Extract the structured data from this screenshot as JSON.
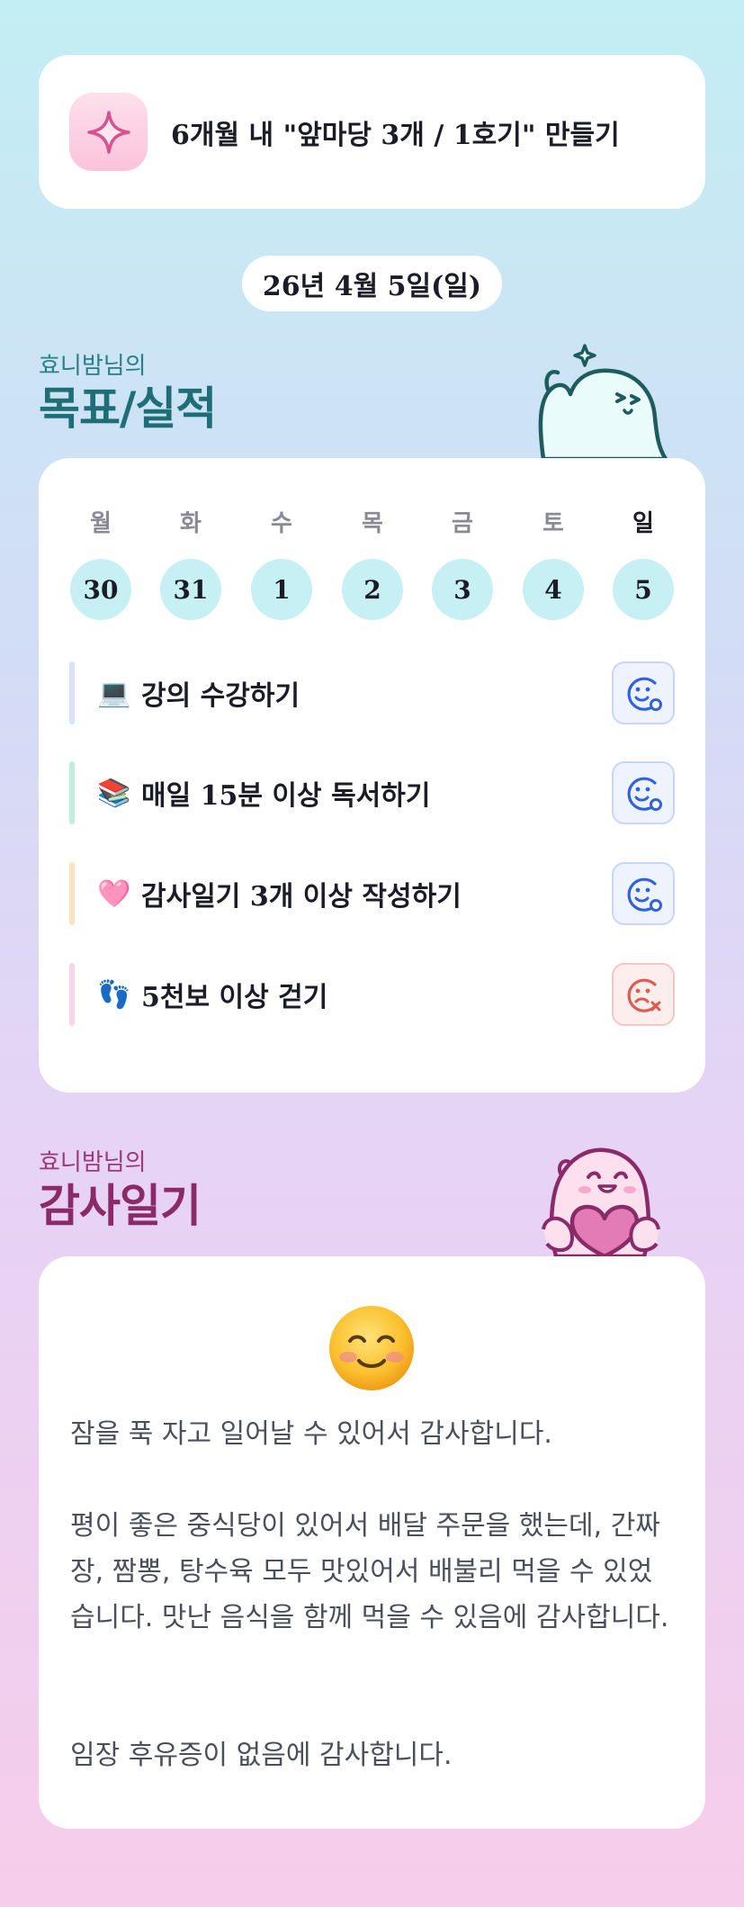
{
  "goal_banner": {
    "icon": "sparkle-icon",
    "text": "6개월 내 \"앞마당 3개 / 1호기\" 만들기"
  },
  "date": "26년 4월 5일(일)",
  "goals_section": {
    "subtitle": "효니밤님의",
    "title": "목표/실적"
  },
  "week": {
    "days": [
      "월",
      "화",
      "수",
      "목",
      "금",
      "토",
      "일"
    ],
    "dates": [
      "30",
      "31",
      "1",
      "2",
      "3",
      "4",
      "5"
    ],
    "today_index": 6
  },
  "tasks": [
    {
      "emoji": "💻",
      "label": "강의 수강하기",
      "bar_color": "#d9e2fb",
      "status": "done",
      "status_icon": "smile-check-icon"
    },
    {
      "emoji": "📚",
      "label": "매일 15분 이상 독서하기",
      "bar_color": "#bfeedd",
      "status": "done",
      "status_icon": "smile-check-icon"
    },
    {
      "emoji": "🩷",
      "label": "감사일기 3개 이상 작성하기",
      "bar_color": "#fde3c2",
      "status": "done",
      "status_icon": "smile-check-icon"
    },
    {
      "emoji": "👣",
      "label": "5천보 이상 걷기",
      "bar_color": "#fcd3e8",
      "status": "fail",
      "status_icon": "sad-x-icon"
    }
  ],
  "diary_section": {
    "subtitle": "효니밤님의",
    "title": "감사일기"
  },
  "diary": {
    "mood_icon": "blushing-smile-icon",
    "paragraphs": [
      "잠을 푹 자고 일어날 수 있어서 감사합니다.",
      "평이 좋은 중식당이 있어서 배달 주문을 했는데, 간짜장, 짬뽕, 탕수육 모두 맛있어서 배불리 먹을 수 있었습니다. 맛난 음식을 함께 먹을 수 있음에 감사합니다.",
      "임장 후유증이 없음에 감사합니다."
    ]
  },
  "colors": {
    "done_icon": "#2f62e0",
    "fail_icon": "#e05a4e",
    "day_circle": "#c6f0f3",
    "goals_title": "#1e6e78",
    "diary_title": "#8a2a68"
  }
}
